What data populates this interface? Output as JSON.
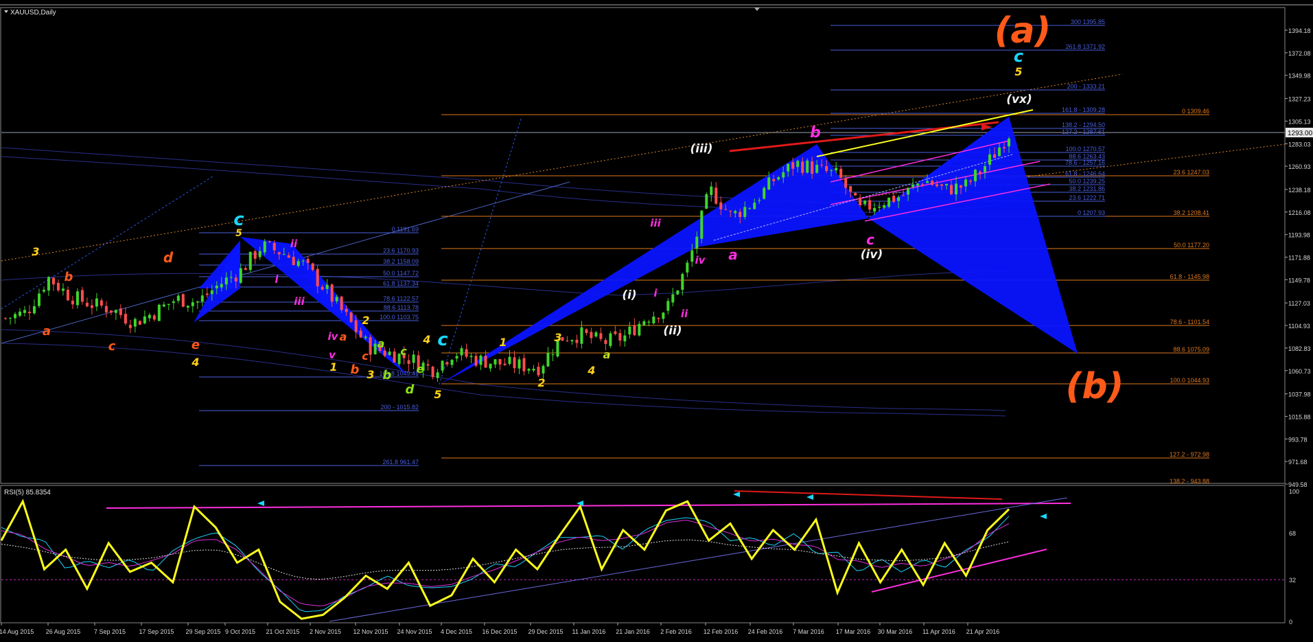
{
  "window": {
    "symbol_title": "XAUUSD,Daily",
    "rsi_title": "RSI(5) 85.8354"
  },
  "price_axis": {
    "current_price": "1293.00",
    "labels": [
      "1394.18",
      "1372.08",
      "1349.98",
      "1327.23",
      "1305.13",
      "1283.03",
      "1260.93",
      "1238.18",
      "1216.08",
      "1193.98",
      "1171.88",
      "1149.78",
      "1127.03",
      "1104.93",
      "1082.83",
      "1060.73",
      "1037.98",
      "1015.88",
      "993.78",
      "971.68",
      "949.58"
    ]
  },
  "rsi_axis": {
    "labels": [
      "100",
      "68",
      "32",
      "0"
    ]
  },
  "date_axis": {
    "labels": [
      "14 Aug 2015",
      "26 Aug 2015",
      "7 Sep 2015",
      "17 Sep 2015",
      "29 Sep 2015",
      "9 Oct 2015",
      "21 Oct 2015",
      "2 Nov 2015",
      "12 Nov 2015",
      "24 Nov 2015",
      "4 Dec 2015",
      "16 Dec 2015",
      "29 Dec 2015",
      "11 Jan 2016",
      "21 Jan 2016",
      "2 Feb 2016",
      "12 Feb 2016",
      "24 Feb 2016",
      "7 Mar 2016",
      "17 Mar 2016",
      "30 Mar 2016",
      "11 Apr 2016",
      "21 Apr 2016"
    ]
  },
  "fib_left": [
    "0 1191.69",
    "23.6 1170.93",
    "38.2 1158.09",
    "50.0 1147.72",
    "61.8 1137.34",
    "78.6 1122.57",
    "88.6 1113.78",
    "100.0 1103.75",
    "161.8 1049.41",
    "200 - 1015.82",
    "261.8 961.47"
  ],
  "fib_right_orange": [
    "0 1309.46",
    "23.6 1247.03",
    "38.2 1208.41",
    "50.0 1177.20",
    "61.8 - 1145.98",
    "78.6 - 1101.54",
    "88.6 1075.09",
    "100.0 1044.93",
    "127.2 - 972.98",
    "138.2 - 943.88"
  ],
  "fib_right_blue": [
    "300 1395.85",
    "261.8 1371.92",
    "200 - 1333.21",
    "161.8 - 1309.28",
    "138.2 - 1294.50",
    "127.2 - 1287.61",
    "100.0 1270.57",
    "88.6 1263.43",
    "78.6 - 1257.16",
    "61.8 - 1246.64",
    "50.0 1239.25",
    "38.2 1231.86",
    "23.6 1222.71",
    "0 1207.93"
  ],
  "wave_labels": {
    "big_a": "(a)",
    "big_b": "(b)",
    "c_top": "c",
    "five": "5",
    "vx": "(vx)",
    "b": "b",
    "iii_paren": "(iii)",
    "iv_paren": "(iv)",
    "ii_paren": "(ii)",
    "i_paren": "(i)",
    "c": "c",
    "a": "a",
    "d": "d",
    "e": "e",
    "one": "1",
    "two": "2",
    "three": "3",
    "four": "4",
    "roman_i": "i",
    "roman_ii": "ii",
    "roman_iii": "iii",
    "roman_iv": "iv",
    "roman_v": "v"
  },
  "colors": {
    "background": "#000000",
    "bull_candle": "#3fd62b",
    "bear_candle": "#ff4d4d",
    "harmonic_fill": "#0a14ff",
    "rsi_line": "#ffff1a",
    "fib_orange": "#e07a1e",
    "fib_blue": "#4a5fe0",
    "wave_orange": "#ff5a1a",
    "wave_magenta": "#ff2ee0",
    "wave_yellow": "#ffd21a",
    "wave_cyan": "#1ad6ff"
  },
  "chart_data": [
    {
      "type": "candlestick",
      "title": "XAUUSD,Daily",
      "x": [
        "2015-08-10",
        "2015-08-14",
        "2015-08-20",
        "2015-08-26",
        "2015-09-01",
        "2015-09-07",
        "2015-09-11",
        "2015-09-17",
        "2015-09-23",
        "2015-09-29",
        "2015-10-05",
        "2015-10-09",
        "2015-10-15",
        "2015-10-21",
        "2015-10-27",
        "2015-11-02",
        "2015-11-06",
        "2015-11-12",
        "2015-11-18",
        "2015-11-24",
        "2015-11-30",
        "2015-12-04",
        "2015-12-10",
        "2015-12-16",
        "2015-12-22",
        "2015-12-29",
        "2016-01-05",
        "2016-01-11",
        "2016-01-15",
        "2016-01-21",
        "2016-01-27",
        "2016-02-02",
        "2016-02-08",
        "2016-02-12",
        "2016-02-18",
        "2016-02-24",
        "2016-03-01",
        "2016-03-07",
        "2016-03-11",
        "2016-03-17",
        "2016-03-23",
        "2016-03-30",
        "2016-04-05",
        "2016-04-11",
        "2016-04-15",
        "2016-04-21",
        "2016-04-27",
        "2016-04-29"
      ],
      "close": [
        1112,
        1118,
        1152,
        1134,
        1126,
        1121,
        1108,
        1118,
        1131,
        1128,
        1145,
        1158,
        1183,
        1176,
        1164,
        1140,
        1112,
        1084,
        1078,
        1072,
        1062,
        1079,
        1072,
        1068,
        1066,
        1064,
        1093,
        1096,
        1088,
        1094,
        1113,
        1122,
        1166,
        1238,
        1212,
        1225,
        1248,
        1264,
        1258,
        1252,
        1218,
        1226,
        1232,
        1248,
        1238,
        1242,
        1264,
        1293
      ],
      "ylabel": "",
      "ylim": [
        940,
        1405
      ],
      "annotations": [
        "(a)",
        "(b)",
        "(iii)",
        "(iv)",
        "(vx)",
        "(i)",
        "(ii)"
      ]
    },
    {
      "type": "line",
      "title": "RSI(5) 85.8354",
      "series": [
        {
          "name": "RSI(5)",
          "values": [
            62,
            92,
            40,
            55,
            25,
            60,
            38,
            45,
            30,
            88,
            72,
            45,
            55,
            15,
            2,
            5,
            18,
            35,
            25,
            45,
            12,
            20,
            48,
            30,
            55,
            40,
            65,
            88,
            40,
            70,
            55,
            85,
            92,
            62,
            75,
            48,
            70,
            55,
            78,
            22,
            60,
            30,
            55,
            28,
            60,
            35,
            70,
            86
          ]
        }
      ],
      "ylim": [
        0,
        100
      ],
      "levels": [
        32,
        68
      ]
    }
  ]
}
